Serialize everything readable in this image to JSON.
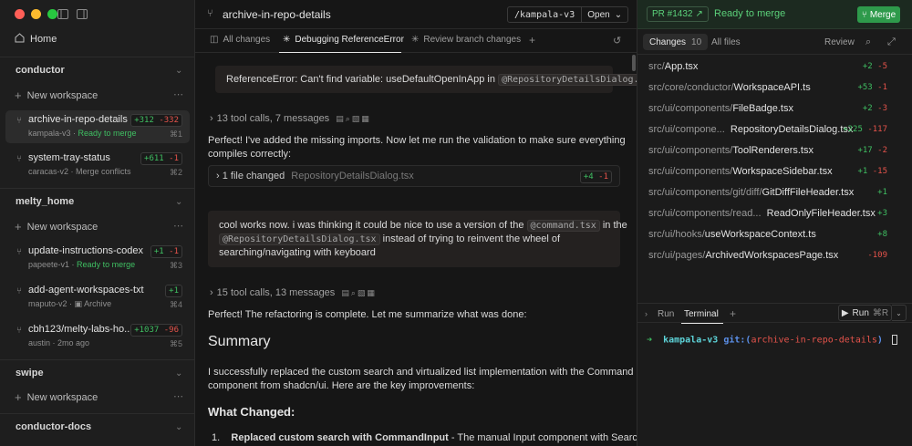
{
  "sidebar": {
    "home_label": "Home",
    "new_workspace_label": "New workspace",
    "sections": [
      {
        "title": "conductor",
        "workspaces": [
          {
            "name": "archive-in-repo-details",
            "repo": "kampala-v3",
            "status": "Ready to merge",
            "additions": "+312",
            "deletions": "-332",
            "shortcut": "⌘1"
          },
          {
            "name": "system-tray-status",
            "repo": "caracas-v2",
            "status": "Merge conflicts",
            "additions": "+611",
            "deletions": "-1",
            "shortcut": "⌘2"
          }
        ]
      },
      {
        "title": "melty_home",
        "workspaces": [
          {
            "name": "update-instructions-codex",
            "repo": "papeete-v1",
            "status": "Ready to merge",
            "additions": "+1",
            "deletions": "-1",
            "shortcut": "⌘3"
          },
          {
            "name": "add-agent-workspaces-txt",
            "repo": "maputo-v2",
            "status": "Archive",
            "additions": "+1",
            "deletions": "",
            "shortcut": "⌘4"
          },
          {
            "name": "cbh123/melty-labs-ho...",
            "repo": "austin",
            "status": "2mo ago",
            "additions": "+1037",
            "deletions": "-96",
            "shortcut": "⌘5"
          }
        ]
      },
      {
        "title": "swipe",
        "workspaces": []
      },
      {
        "title": "conductor-docs",
        "workspaces": []
      }
    ]
  },
  "main": {
    "title": "archive-in-repo-details",
    "repo_selector": "/kampala-v3",
    "open_label": "Open",
    "tabs": [
      {
        "label": "All changes"
      },
      {
        "label": "Debugging ReferenceError"
      },
      {
        "label": "Review branch changes"
      }
    ],
    "messages": {
      "error_text": "ReferenceError: Can't find variable: useDefaultOpenInApp in",
      "error_file": "@RepositoryDetailsDialog.tsx",
      "tool_calls_1": "13 tool calls, 7 messages",
      "para_1a": "Perfect! I've added the missing imports. Now let me run the validation to make sure everything",
      "para_1b": "compiles correctly:",
      "file_changed_label": "1 file changed",
      "file_changed_name": "RepositoryDetailsDialog.tsx",
      "file_changed_add": "+4",
      "file_changed_del": "-1",
      "user_1a": "cool works now. i was thinking it could be nice to use a version of the",
      "user_pill_1": "@command.tsx",
      "user_1b": "in the",
      "user_pill_2": "@RepositoryDetailsDialog.tsx",
      "user_2a": "instead of trying to reinvent the wheel of",
      "user_3": "searching/navigating with keyboard",
      "tool_calls_2": "15 tool calls, 13 messages",
      "para_2": "Perfect! The refactoring is complete. Let me summarize what was done:",
      "summary_heading": "Summary",
      "summary_1": "I successfully replaced the custom search and virtualized list implementation with the Command",
      "summary_2": "component from shadcn/ui. Here are the key improvements:",
      "changed_heading": "What Changed:",
      "item_num": "1.",
      "item_bold": "Replaced custom search with CommandInput",
      "item_rest": " - The manual Input component with Search"
    }
  },
  "right": {
    "pr_label": "PR #1432",
    "pr_status": "Ready to merge",
    "merge_label": "Merge",
    "tab_changes": "Changes",
    "changes_count": "10",
    "tab_all_files": "All files",
    "review_label": "Review",
    "files": [
      {
        "dir": "src/",
        "name": "App.tsx",
        "add": "+2",
        "del": "-5"
      },
      {
        "dir": "src/core/conductor/",
        "name": "WorkspaceAPI.ts",
        "add": "+53",
        "del": "-1"
      },
      {
        "dir": "src/ui/components/",
        "name": "FileBadge.tsx",
        "add": "+2",
        "del": "-3"
      },
      {
        "dir": "src/ui/compone...",
        "name": "RepositoryDetailsDialog.tsx",
        "add": "+225",
        "del": "-117"
      },
      {
        "dir": "src/ui/components/",
        "name": "ToolRenderers.tsx",
        "add": "+17",
        "del": "-2"
      },
      {
        "dir": "src/ui/components/",
        "name": "WorkspaceSidebar.tsx",
        "add": "+1",
        "del": "-15"
      },
      {
        "dir": "src/ui/components/git/diff/",
        "name": "GitDiffFileHeader.tsx",
        "add": "+1",
        "del": ""
      },
      {
        "dir": "src/ui/components/read...",
        "name": "ReadOnlyFileHeader.tsx",
        "add": "+3",
        "del": ""
      },
      {
        "dir": "src/ui/hooks/",
        "name": "useWorkspaceContext.ts",
        "add": "+8",
        "del": ""
      },
      {
        "dir": "src/ui/pages/",
        "name": "ArchivedWorkspacesPage.tsx",
        "add": "",
        "del": "-109"
      }
    ],
    "terminal": {
      "run_tab": "Run",
      "terminal_tab": "Terminal",
      "run_button": "Run",
      "run_shortcut": "⌘R",
      "prompt_arrow": "➜",
      "prompt_dir": "kampala-v3",
      "prompt_git": "git:(",
      "prompt_branch": "archive-in-repo-details",
      "prompt_close": ")"
    }
  },
  "colors": {
    "accent_green": "#3fbf62",
    "deletion_red": "#e5534b",
    "merge_button": "#2e9a4b"
  }
}
